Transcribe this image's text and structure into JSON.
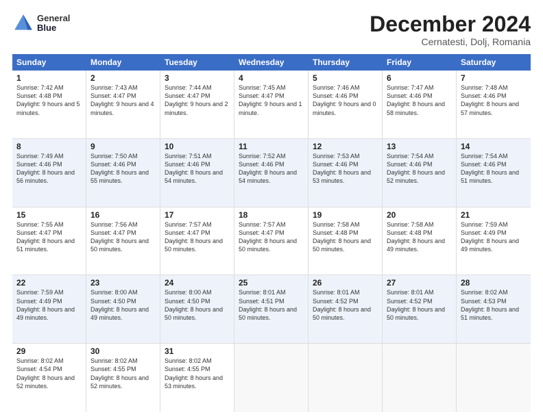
{
  "header": {
    "logo_line1": "General",
    "logo_line2": "Blue",
    "month": "December 2024",
    "location": "Cernatesti, Dolj, Romania"
  },
  "days_of_week": [
    "Sunday",
    "Monday",
    "Tuesday",
    "Wednesday",
    "Thursday",
    "Friday",
    "Saturday"
  ],
  "weeks": [
    [
      {
        "day": "1",
        "sunrise": "7:42 AM",
        "sunset": "4:48 PM",
        "daylight": "9 hours and 5 minutes."
      },
      {
        "day": "2",
        "sunrise": "7:43 AM",
        "sunset": "4:47 PM",
        "daylight": "9 hours and 4 minutes."
      },
      {
        "day": "3",
        "sunrise": "7:44 AM",
        "sunset": "4:47 PM",
        "daylight": "9 hours and 2 minutes."
      },
      {
        "day": "4",
        "sunrise": "7:45 AM",
        "sunset": "4:47 PM",
        "daylight": "9 hours and 1 minute."
      },
      {
        "day": "5",
        "sunrise": "7:46 AM",
        "sunset": "4:46 PM",
        "daylight": "9 hours and 0 minutes."
      },
      {
        "day": "6",
        "sunrise": "7:47 AM",
        "sunset": "4:46 PM",
        "daylight": "8 hours and 58 minutes."
      },
      {
        "day": "7",
        "sunrise": "7:48 AM",
        "sunset": "4:46 PM",
        "daylight": "8 hours and 57 minutes."
      }
    ],
    [
      {
        "day": "8",
        "sunrise": "7:49 AM",
        "sunset": "4:46 PM",
        "daylight": "8 hours and 56 minutes."
      },
      {
        "day": "9",
        "sunrise": "7:50 AM",
        "sunset": "4:46 PM",
        "daylight": "8 hours and 55 minutes."
      },
      {
        "day": "10",
        "sunrise": "7:51 AM",
        "sunset": "4:46 PM",
        "daylight": "8 hours and 54 minutes."
      },
      {
        "day": "11",
        "sunrise": "7:52 AM",
        "sunset": "4:46 PM",
        "daylight": "8 hours and 54 minutes."
      },
      {
        "day": "12",
        "sunrise": "7:53 AM",
        "sunset": "4:46 PM",
        "daylight": "8 hours and 53 minutes."
      },
      {
        "day": "13",
        "sunrise": "7:54 AM",
        "sunset": "4:46 PM",
        "daylight": "8 hours and 52 minutes."
      },
      {
        "day": "14",
        "sunrise": "7:54 AM",
        "sunset": "4:46 PM",
        "daylight": "8 hours and 51 minutes."
      }
    ],
    [
      {
        "day": "15",
        "sunrise": "7:55 AM",
        "sunset": "4:47 PM",
        "daylight": "8 hours and 51 minutes."
      },
      {
        "day": "16",
        "sunrise": "7:56 AM",
        "sunset": "4:47 PM",
        "daylight": "8 hours and 50 minutes."
      },
      {
        "day": "17",
        "sunrise": "7:57 AM",
        "sunset": "4:47 PM",
        "daylight": "8 hours and 50 minutes."
      },
      {
        "day": "18",
        "sunrise": "7:57 AM",
        "sunset": "4:47 PM",
        "daylight": "8 hours and 50 minutes."
      },
      {
        "day": "19",
        "sunrise": "7:58 AM",
        "sunset": "4:48 PM",
        "daylight": "8 hours and 50 minutes."
      },
      {
        "day": "20",
        "sunrise": "7:58 AM",
        "sunset": "4:48 PM",
        "daylight": "8 hours and 49 minutes."
      },
      {
        "day": "21",
        "sunrise": "7:59 AM",
        "sunset": "4:49 PM",
        "daylight": "8 hours and 49 minutes."
      }
    ],
    [
      {
        "day": "22",
        "sunrise": "7:59 AM",
        "sunset": "4:49 PM",
        "daylight": "8 hours and 49 minutes."
      },
      {
        "day": "23",
        "sunrise": "8:00 AM",
        "sunset": "4:50 PM",
        "daylight": "8 hours and 49 minutes."
      },
      {
        "day": "24",
        "sunrise": "8:00 AM",
        "sunset": "4:50 PM",
        "daylight": "8 hours and 50 minutes."
      },
      {
        "day": "25",
        "sunrise": "8:01 AM",
        "sunset": "4:51 PM",
        "daylight": "8 hours and 50 minutes."
      },
      {
        "day": "26",
        "sunrise": "8:01 AM",
        "sunset": "4:52 PM",
        "daylight": "8 hours and 50 minutes."
      },
      {
        "day": "27",
        "sunrise": "8:01 AM",
        "sunset": "4:52 PM",
        "daylight": "8 hours and 50 minutes."
      },
      {
        "day": "28",
        "sunrise": "8:02 AM",
        "sunset": "4:53 PM",
        "daylight": "8 hours and 51 minutes."
      }
    ],
    [
      {
        "day": "29",
        "sunrise": "8:02 AM",
        "sunset": "4:54 PM",
        "daylight": "8 hours and 52 minutes."
      },
      {
        "day": "30",
        "sunrise": "8:02 AM",
        "sunset": "4:55 PM",
        "daylight": "8 hours and 52 minutes."
      },
      {
        "day": "31",
        "sunrise": "8:02 AM",
        "sunset": "4:55 PM",
        "daylight": "8 hours and 53 minutes."
      },
      null,
      null,
      null,
      null
    ]
  ]
}
